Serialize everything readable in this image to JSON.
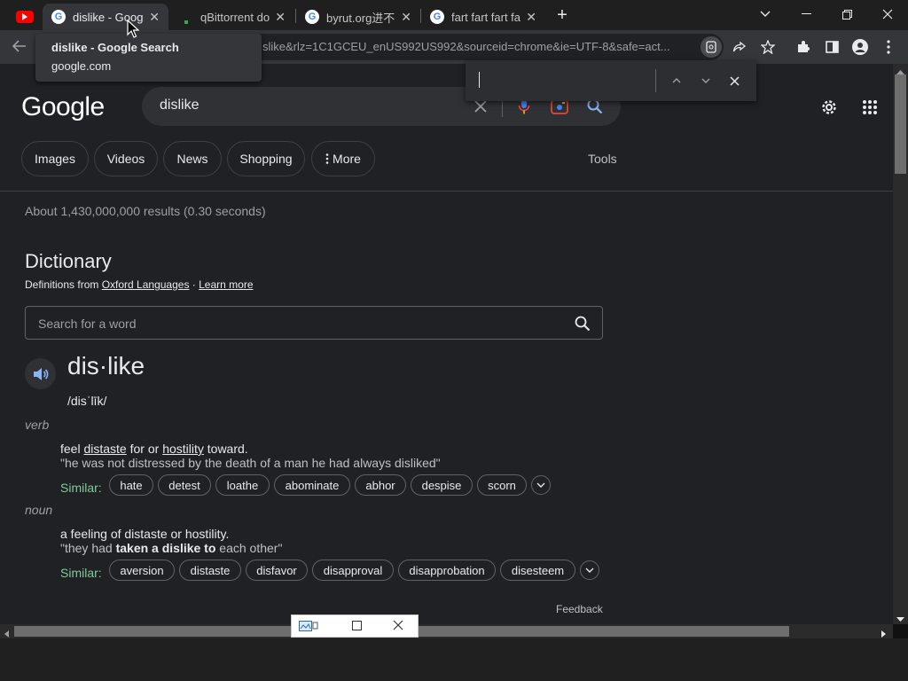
{
  "browser": {
    "tabs": [
      {
        "title": "",
        "icon": "youtube-icon"
      },
      {
        "title": "dislike - Googl",
        "icon": "google-icon",
        "active": true
      },
      {
        "title": "qBittorrent do",
        "icon": "qbittorrent-icon"
      },
      {
        "title": "byrut.org进不去",
        "icon": "google-icon"
      },
      {
        "title": "fart fart fart fa",
        "icon": "google-icon"
      }
    ],
    "tab_close": "✕",
    "new_tab": "+",
    "url": "slike&rlz=1C1GCEU_enUS992US992&sourceid=chrome&ie=UTF-8&safe=act...",
    "tooltip": {
      "title": "dislike - Google Search",
      "domain": "google.com"
    }
  },
  "google": {
    "logo": "Google",
    "query": "dislike",
    "chips": [
      "Images",
      "Videos",
      "News",
      "Shopping",
      "More"
    ],
    "tools": "Tools",
    "stats": "About 1,430,000,000 results (0.30 seconds)"
  },
  "dictionary": {
    "title": "Dictionary",
    "from_prefix": "Definitions from ",
    "source": "Oxford Languages",
    "dot": " · ",
    "learn_more": "Learn more",
    "search_placeholder": "Search for a word",
    "headword": "dis·like",
    "phonetic": "/disˈlīk/",
    "verb": {
      "pos": "verb",
      "def_a": "feel ",
      "def_link1": "distaste",
      "def_b": " for or ",
      "def_link2": "hostility",
      "def_c": " toward.",
      "example": "\"he was not distressed by the death of a man he had always disliked\"",
      "similar_label": "Similar:",
      "similar": [
        "hate",
        "detest",
        "loathe",
        "abominate",
        "abhor",
        "despise",
        "scorn"
      ]
    },
    "noun": {
      "pos": "noun",
      "definition": "a feeling of distaste or hostility.",
      "ex_a": "\"they had ",
      "ex_bold": "taken a dislike to",
      "ex_b": " each other\"",
      "similar_label": "Similar:",
      "similar": [
        "aversion",
        "distaste",
        "disfavor",
        "disapproval",
        "disapprobation",
        "disesteem"
      ]
    },
    "feedback": "Feedback"
  },
  "colors": {
    "background": "#202124",
    "similar_label": "#81c995",
    "speaker": "#8ab4f8"
  }
}
